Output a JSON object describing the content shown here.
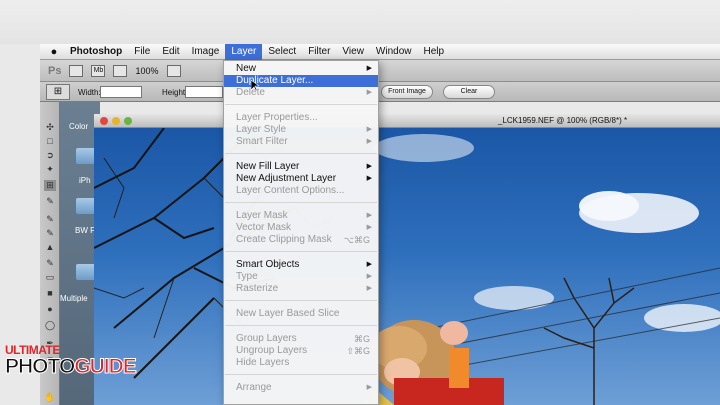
{
  "menubar": {
    "app_name": "Photoshop",
    "items": [
      "File",
      "Edit",
      "Image",
      "Layer",
      "Select",
      "Filter",
      "View",
      "Window",
      "Help"
    ],
    "active_item": "Layer"
  },
  "appbar": {
    "logo": "Ps",
    "mb_label": "Mb",
    "zoom": "100%"
  },
  "options_bar": {
    "width_label": "Width:",
    "height_label": "Height:",
    "front_image_button": "Front Image",
    "clear_button": "Clear"
  },
  "desktop": {
    "labels": [
      "Color",
      "iPh",
      "BW F",
      "Multiple"
    ]
  },
  "document": {
    "title": "_LCK1959.NEF @ 100% (RGB/8*) *"
  },
  "layer_menu": {
    "items": [
      {
        "label": "New",
        "enabled": true,
        "submenu": true
      },
      {
        "label": "Duplicate Layer...",
        "enabled": true,
        "highlighted": true
      },
      {
        "label": "Delete",
        "enabled": false,
        "submenu": true
      },
      {
        "label": "Layer Properties...",
        "enabled": false
      },
      {
        "label": "Layer Style",
        "enabled": false,
        "submenu": true
      },
      {
        "label": "Smart Filter",
        "enabled": false,
        "submenu": true
      },
      {
        "label": "New Fill Layer",
        "enabled": true,
        "submenu": true
      },
      {
        "label": "New Adjustment Layer",
        "enabled": true,
        "submenu": true
      },
      {
        "label": "Layer Content Options...",
        "enabled": false
      },
      {
        "label": "Layer Mask",
        "enabled": false,
        "submenu": true
      },
      {
        "label": "Vector Mask",
        "enabled": false,
        "submenu": true
      },
      {
        "label": "Create Clipping Mask",
        "enabled": false,
        "shortcut": "⌥⌘G"
      },
      {
        "label": "Smart Objects",
        "enabled": true,
        "submenu": true
      },
      {
        "label": "Type",
        "enabled": false,
        "submenu": true
      },
      {
        "label": "Rasterize",
        "enabled": false,
        "submenu": true
      },
      {
        "label": "New Layer Based Slice",
        "enabled": false
      },
      {
        "label": "Group Layers",
        "enabled": false,
        "shortcut": "⌘G"
      },
      {
        "label": "Ungroup Layers",
        "enabled": false,
        "shortcut": "⇧⌘G"
      },
      {
        "label": "Hide Layers",
        "enabled": false
      },
      {
        "label": "Arrange",
        "enabled": false,
        "submenu": true
      }
    ],
    "arrow_glyph": "▶"
  },
  "logo": {
    "top": "ULTIMATE",
    "bottom_a": "PHOTO",
    "bottom_b": "GUIDE"
  },
  "colors": {
    "menu_highlight": "#3e6fd8",
    "logo_red": "#e0262c",
    "sky_blue": "#2e6fbc"
  }
}
